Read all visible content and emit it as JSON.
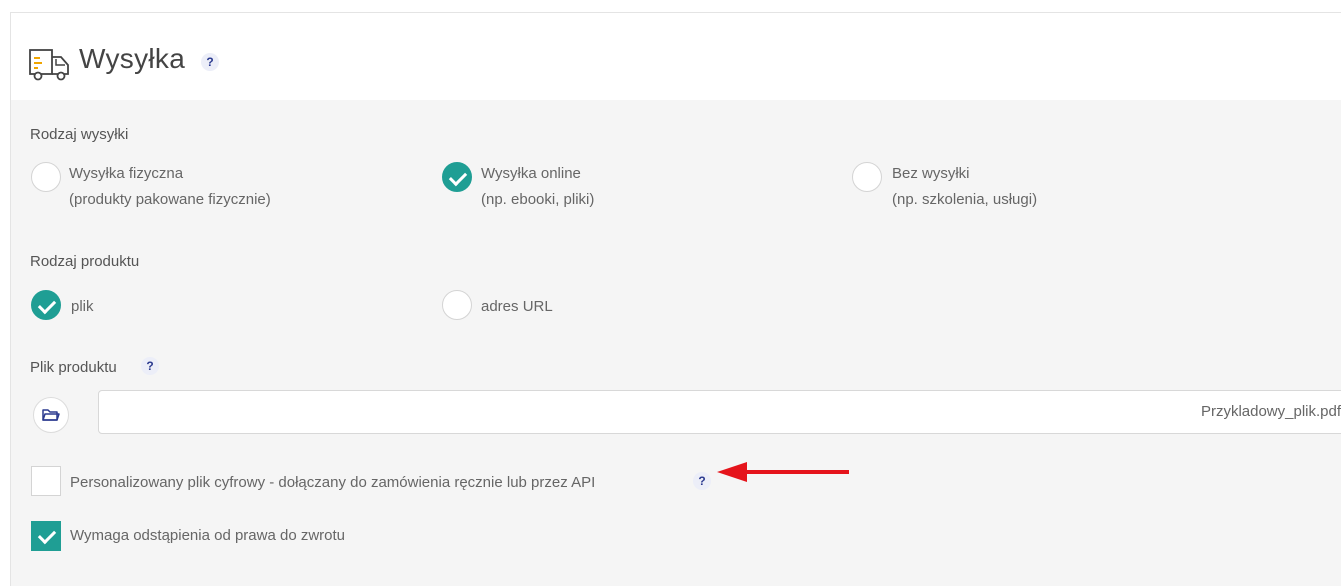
{
  "header": {
    "title": "Wysyłka",
    "help": "?"
  },
  "shipping_type": {
    "label": "Rodzaj wysyłki",
    "options": [
      {
        "title": "Wysyłka fizyczna",
        "subtitle": "(produkty pakowane fizycznie)",
        "checked": false
      },
      {
        "title": "Wysyłka online",
        "subtitle": "(np. ebooki, pliki)",
        "checked": true
      },
      {
        "title": "Bez wysyłki",
        "subtitle": "(np. szkolenia, usługi)",
        "checked": false
      }
    ]
  },
  "product_type": {
    "label": "Rodzaj produktu",
    "options": [
      {
        "title": "plik",
        "checked": true
      },
      {
        "title": "adres URL",
        "checked": false
      }
    ]
  },
  "product_file": {
    "label": "Plik produktu",
    "help": "?",
    "value": "Przykladowy_plik.pdf"
  },
  "personalized": {
    "label": "Personalizowany plik cyfrowy - dołączany do zamówienia ręcznie lub przez API",
    "help": "?",
    "checked": false
  },
  "withdrawal": {
    "label": "Wymaga odstąpienia od prawa do zwrotu",
    "checked": true
  },
  "colors": {
    "accent": "#1f9e94",
    "arrow": "#e5141b",
    "help_text": "#2b3a8f"
  }
}
